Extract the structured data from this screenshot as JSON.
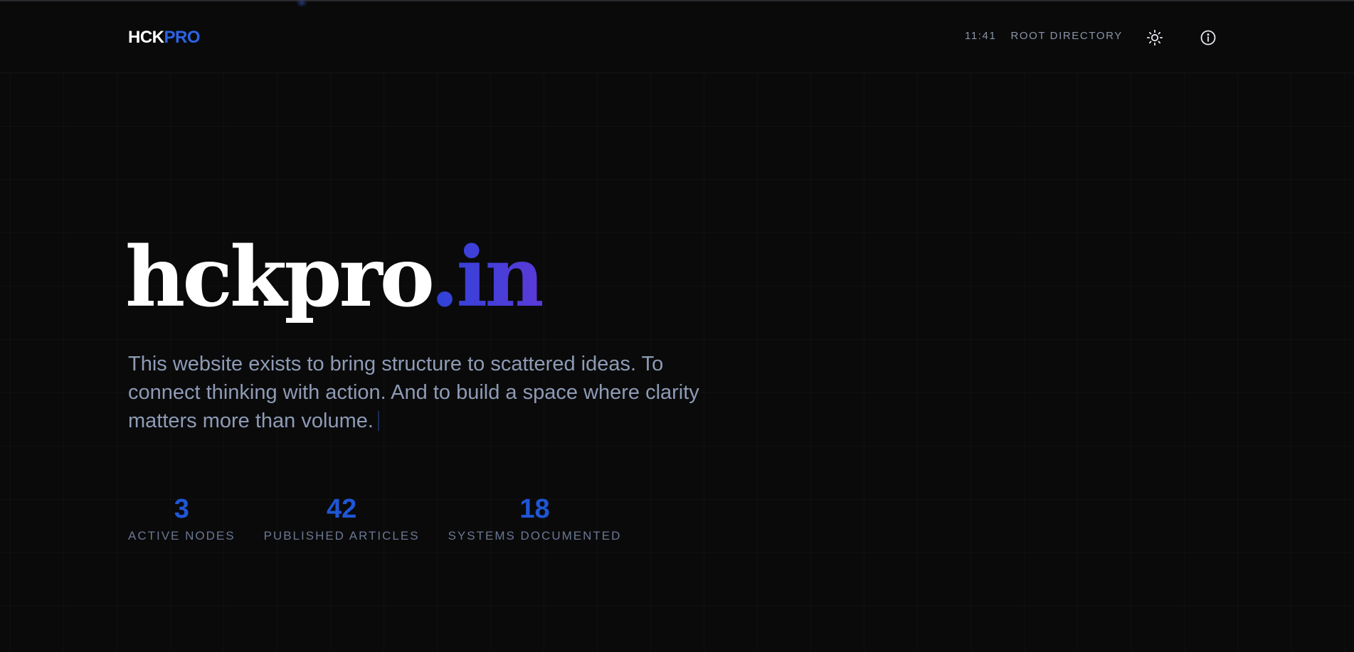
{
  "header": {
    "logo_part_a": "HCK",
    "logo_part_b": "PRO",
    "clock": "11:41",
    "root_label": "ROOT DIRECTORY",
    "theme_icon": "sun-icon",
    "info_icon": "info-icon"
  },
  "hero": {
    "title_main": "hckpro",
    "title_accent": ".in",
    "description": "This website exists to bring structure to scattered ideas. To connect thinking with action. And to build a space where clarity matters more than volume."
  },
  "stats": [
    {
      "value": "3",
      "label": "ACTIVE NODES"
    },
    {
      "value": "42",
      "label": "PUBLISHED ARTICLES"
    },
    {
      "value": "18",
      "label": "SYSTEMS DOCUMENTED"
    }
  ],
  "colors": {
    "background": "#0a0a0b",
    "accent": "#2b63e6",
    "accent_gradient_start": "#2d43d9",
    "accent_gradient_end": "#5a3ad8",
    "muted_text": "#8e9bb5",
    "stat_value": "#1f56d6"
  }
}
